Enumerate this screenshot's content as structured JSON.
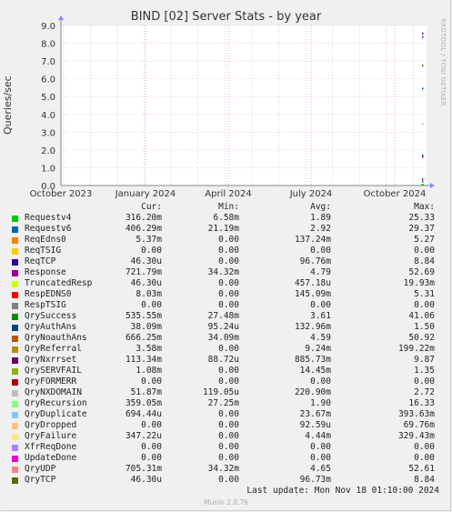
{
  "chart_data": {
    "type": "line",
    "title": "BIND [02] Server Stats - by year",
    "ylabel": "Queries/sec",
    "xlabel": "",
    "ylim": [
      0,
      9
    ],
    "yticks": [
      "0.0",
      "1.0",
      "2.0",
      "3.0",
      "4.0",
      "5.0",
      "6.0",
      "7.0",
      "8.0",
      "9.0"
    ],
    "xticks": [
      "October 2023",
      "January 2024",
      "April 2024",
      "July 2024",
      "October 2024"
    ],
    "grid": true,
    "series": [
      {
        "name": "Requestv4",
        "color": "#00cc00",
        "cur": "316.20m",
        "min": "6.58m",
        "avg": "1.89",
        "max": "25.33"
      },
      {
        "name": "Requestv6",
        "color": "#0066b3",
        "cur": "406.29m",
        "min": "21.19m",
        "avg": "2.92",
        "max": "29.37"
      },
      {
        "name": "ReqEdns0",
        "color": "#ff8000",
        "cur": "5.37m",
        "min": "0.00",
        "avg": "137.24m",
        "max": "5.27"
      },
      {
        "name": "ReqTSIG",
        "color": "#ffcc00",
        "cur": "0.00",
        "min": "0.00",
        "avg": "0.00",
        "max": "0.00"
      },
      {
        "name": "ReqTCP",
        "color": "#330099",
        "cur": "46.30u",
        "min": "0.00",
        "avg": "96.76m",
        "max": "8.84"
      },
      {
        "name": "Response",
        "color": "#990099",
        "cur": "721.79m",
        "min": "34.32m",
        "avg": "4.79",
        "max": "52.69"
      },
      {
        "name": "TruncatedResp",
        "color": "#ccff00",
        "cur": "46.30u",
        "min": "0.00",
        "avg": "457.18u",
        "max": "19.93m"
      },
      {
        "name": "RespEDNS0",
        "color": "#ff0000",
        "cur": "8.03m",
        "min": "0.00",
        "avg": "145.09m",
        "max": "5.31"
      },
      {
        "name": "RespTSIG",
        "color": "#808080",
        "cur": "0.00",
        "min": "0.00",
        "avg": "0.00",
        "max": "0.00"
      },
      {
        "name": "QrySuccess",
        "color": "#008f00",
        "cur": "535.55m",
        "min": "27.48m",
        "avg": "3.61",
        "max": "41.06"
      },
      {
        "name": "QryAuthAns",
        "color": "#00487d",
        "cur": "38.09m",
        "min": "95.24u",
        "avg": "132.96m",
        "max": "1.50"
      },
      {
        "name": "QryNoauthAns",
        "color": "#b35a00",
        "cur": "666.25m",
        "min": "34.09m",
        "avg": "4.59",
        "max": "50.92"
      },
      {
        "name": "QryReferral",
        "color": "#b38f00",
        "cur": "3.58m",
        "min": "0.00",
        "avg": "9.24m",
        "max": "199.22m"
      },
      {
        "name": "QryNxrrset",
        "color": "#6b006b",
        "cur": "113.34m",
        "min": "88.72u",
        "avg": "885.73m",
        "max": "9.87"
      },
      {
        "name": "QrySERVFAIL",
        "color": "#8fb300",
        "cur": "1.08m",
        "min": "0.00",
        "avg": "14.45m",
        "max": "1.35"
      },
      {
        "name": "QryFORMERR",
        "color": "#b30000",
        "cur": "0.00",
        "min": "0.00",
        "avg": "0.00",
        "max": "0.00"
      },
      {
        "name": "QryNXDOMAIN",
        "color": "#bebebe",
        "cur": "51.87m",
        "min": "119.05u",
        "avg": "220.90m",
        "max": "2.72"
      },
      {
        "name": "QryRecursion",
        "color": "#80ff80",
        "cur": "359.05m",
        "min": "27.25m",
        "avg": "1.90",
        "max": "16.33"
      },
      {
        "name": "QryDuplicate",
        "color": "#80c9ff",
        "cur": "694.44u",
        "min": "0.00",
        "avg": "23.67m",
        "max": "393.63m"
      },
      {
        "name": "QryDropped",
        "color": "#ffc080",
        "cur": "0.00",
        "min": "0.00",
        "avg": "92.59u",
        "max": "69.76m"
      },
      {
        "name": "QryFailure",
        "color": "#ffe680",
        "cur": "347.22u",
        "min": "0.00",
        "avg": "4.44m",
        "max": "329.43m"
      },
      {
        "name": "XfrReqDone",
        "color": "#aa80ff",
        "cur": "0.00",
        "min": "0.00",
        "avg": "0.00",
        "max": "0.00"
      },
      {
        "name": "UpdateDone",
        "color": "#ee00cc",
        "cur": "0.00",
        "min": "0.00",
        "avg": "0.00",
        "max": "0.00"
      },
      {
        "name": "QryUDP",
        "color": "#ff8080",
        "cur": "705.31m",
        "min": "34.32m",
        "avg": "4.65",
        "max": "52.61"
      },
      {
        "name": "QryTCP",
        "color": "#666600",
        "cur": "46.30u",
        "min": "0.00",
        "avg": "96.73m",
        "max": "8.84"
      }
    ]
  },
  "side_credit": "RRDTOOL / TOBI OETIKER",
  "legend_headers": {
    "cur": "Cur:",
    "min": "Min:",
    "avg": "Avg:",
    "max": "Max:"
  },
  "last_update": "Last update: Mon Nov 18 01:10:00 2024",
  "footer": "Munin 2.0.76"
}
